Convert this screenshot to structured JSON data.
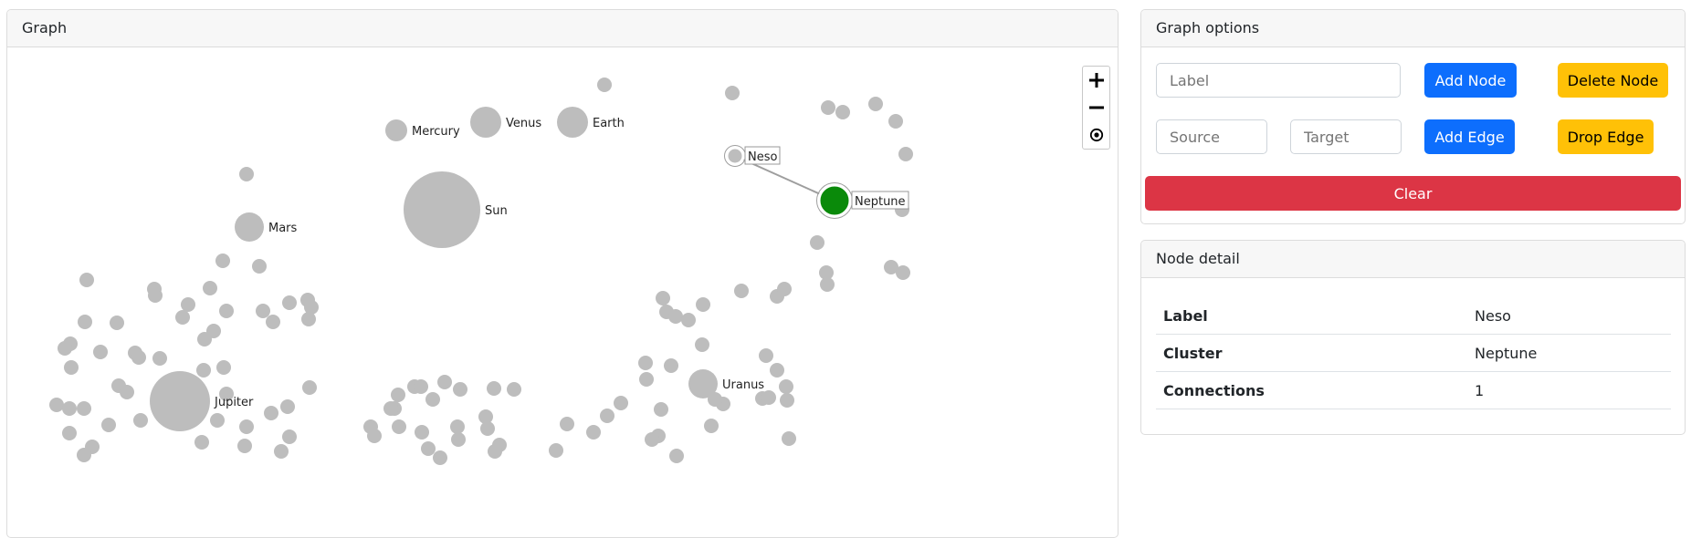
{
  "graph_panel": {
    "title": "Graph"
  },
  "zoom": {
    "in_icon": "plus-icon",
    "out_icon": "minus-icon",
    "fit_icon": "target-icon"
  },
  "colors": {
    "node": "#bdbdbd",
    "selected_node": "#0a8a0a",
    "edge": "#9e9e9e",
    "primary": "#0d6efd",
    "warning": "#ffc107",
    "danger": "#dc3545"
  },
  "nodes": [
    {
      "label": "Mercury"
    },
    {
      "label": "Venus"
    },
    {
      "label": "Earth"
    },
    {
      "label": "Sun"
    },
    {
      "label": "Mars"
    },
    {
      "label": "Neso"
    },
    {
      "label": "Neptune"
    },
    {
      "label": "Jupiter"
    },
    {
      "label": "Uranus"
    }
  ],
  "edges": [
    {
      "source": "Neso",
      "target": "Neptune"
    }
  ],
  "selected_node": "Neptune",
  "options": {
    "title": "Graph options",
    "label_placeholder": "Label",
    "add_node": "Add Node",
    "delete_node": "Delete Node",
    "source_placeholder": "Source",
    "target_placeholder": "Target",
    "add_edge": "Add Edge",
    "drop_edge": "Drop Edge",
    "clear": "Clear"
  },
  "detail": {
    "title": "Node detail",
    "rows": [
      {
        "key": "Label",
        "value": "Neso"
      },
      {
        "key": "Cluster",
        "value": "Neptune"
      },
      {
        "key": "Connections",
        "value": "1"
      }
    ]
  }
}
